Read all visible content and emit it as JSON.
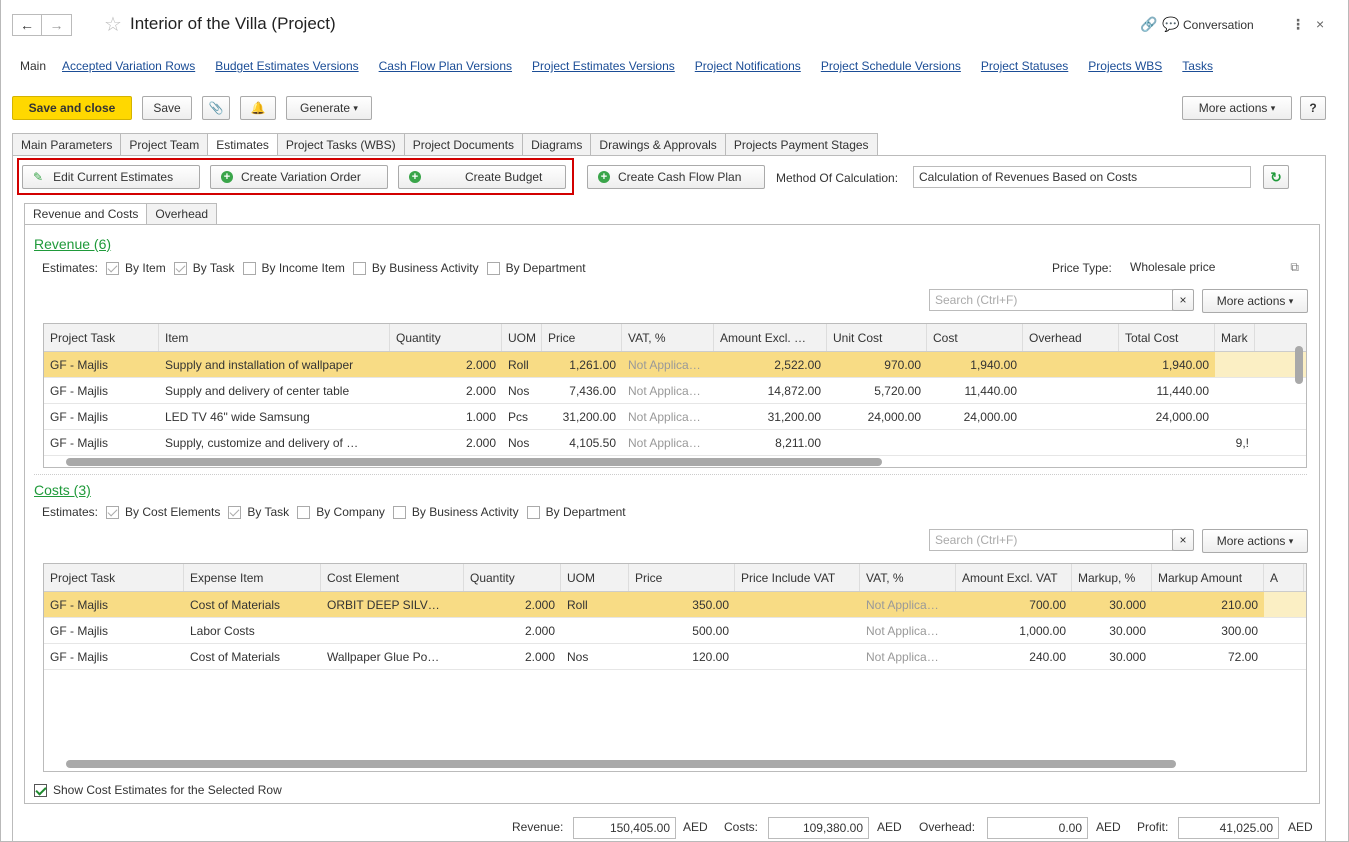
{
  "window": {
    "title": "Interior of the Villa (Project)",
    "conversation_label": "Conversation"
  },
  "links": [
    "Main",
    "Accepted Variation Rows",
    "Budget Estimates Versions",
    "Cash Flow Plan Versions",
    "Project Estimates Versions",
    "Project Notifications",
    "Project Schedule Versions",
    "Project Statuses",
    "Projects WBS",
    "Tasks"
  ],
  "toolbar": {
    "save_close": "Save and close",
    "save": "Save",
    "generate": "Generate",
    "more_actions": "More actions",
    "help": "?"
  },
  "main_tabs": [
    "Main Parameters",
    "Project Team",
    "Estimates",
    "Project Tasks (WBS)",
    "Project Documents",
    "Diagrams",
    "Drawings & Approvals",
    "Projects Payment Stages"
  ],
  "actions": {
    "edit_estimates": "Edit Current Estimates",
    "create_variation": "Create Variation Order",
    "create_budget": "Create Budget",
    "create_cashflow": "Create Cash Flow Plan",
    "method_label": "Method Of Calculation:",
    "method_value": "Calculation of Revenues Based on Costs"
  },
  "sub_tabs": [
    "Revenue and Costs",
    "Overhead"
  ],
  "revenue": {
    "title": "Revenue (6)",
    "estimates_label": "Estimates:",
    "filters": [
      {
        "label": "By Item",
        "checked": true
      },
      {
        "label": "By Task",
        "checked": true
      },
      {
        "label": "By Income Item",
        "checked": false
      },
      {
        "label": "By Business Activity",
        "checked": false
      },
      {
        "label": "By Department",
        "checked": false
      }
    ],
    "price_type_label": "Price Type:",
    "price_type_value": "Wholesale price",
    "search_placeholder": "Search (Ctrl+F)",
    "more_actions": "More actions",
    "columns": [
      "Project Task",
      "Item",
      "Quantity",
      "UOM",
      "Price",
      "VAT, %",
      "Amount Excl. …",
      "Unit Cost",
      "Cost",
      "Overhead",
      "Total Cost",
      "Mark"
    ],
    "rows": [
      [
        "GF - Majlis",
        "Supply and installation of wallpaper",
        "2.000",
        "Roll",
        "1,261.00",
        "Not Applica…",
        "2,522.00",
        "970.00",
        "1,940.00",
        "",
        "1,940.00",
        ""
      ],
      [
        "GF - Majlis",
        "Supply and delivery of center table",
        "2.000",
        "Nos",
        "7,436.00",
        "Not Applica…",
        "14,872.00",
        "5,720.00",
        "11,440.00",
        "",
        "11,440.00",
        ""
      ],
      [
        "GF - Majlis",
        "LED TV 46\" wide Samsung",
        "1.000",
        "Pcs",
        "31,200.00",
        "Not Applica…",
        "31,200.00",
        "24,000.00",
        "24,000.00",
        "",
        "24,000.00",
        ""
      ],
      [
        "GF - Majlis",
        "Supply, customize and delivery of …",
        "2.000",
        "Nos",
        "4,105.50",
        "Not Applica…",
        "8,211.00",
        "",
        "",
        "",
        "",
        "9,!"
      ]
    ]
  },
  "costs": {
    "title": "Costs (3)",
    "estimates_label": "Estimates:",
    "filters": [
      {
        "label": "By Cost Elements",
        "checked": true
      },
      {
        "label": "By Task",
        "checked": true
      },
      {
        "label": "By Company",
        "checked": false
      },
      {
        "label": "By Business Activity",
        "checked": false
      },
      {
        "label": "By Department",
        "checked": false
      }
    ],
    "search_placeholder": "Search (Ctrl+F)",
    "more_actions": "More actions",
    "columns": [
      "Project Task",
      "Expense Item",
      "Cost Element",
      "Quantity",
      "UOM",
      "Price",
      "Price Include VAT",
      "VAT, %",
      "Amount Excl. VAT",
      "Markup, %",
      "Markup Amount",
      "A"
    ],
    "rows": [
      [
        "GF - Majlis",
        "Cost of Materials",
        "ORBIT DEEP SILV…",
        "2.000",
        "Roll",
        "350.00",
        "",
        "Not Applica…",
        "700.00",
        "30.000",
        "210.00",
        ""
      ],
      [
        "GF - Majlis",
        "Labor Costs",
        "",
        "2.000",
        "",
        "500.00",
        "",
        "Not Applica…",
        "1,000.00",
        "30.000",
        "300.00",
        ""
      ],
      [
        "GF - Majlis",
        "Cost of Materials",
        "Wallpaper Glue Po…",
        "2.000",
        "Nos",
        "120.00",
        "",
        "Not Applica…",
        "240.00",
        "30.000",
        "72.00",
        ""
      ]
    ]
  },
  "show_cost_estimates": "Show Cost Estimates for the Selected Row",
  "totals": {
    "revenue_label": "Revenue:",
    "revenue_value": "150,405.00",
    "costs_label": "Costs:",
    "costs_value": "109,380.00",
    "overhead_label": "Overhead:",
    "overhead_value": "0.00",
    "profit_label": "Profit:",
    "profit_value": "41,025.00",
    "currency": "AED"
  }
}
